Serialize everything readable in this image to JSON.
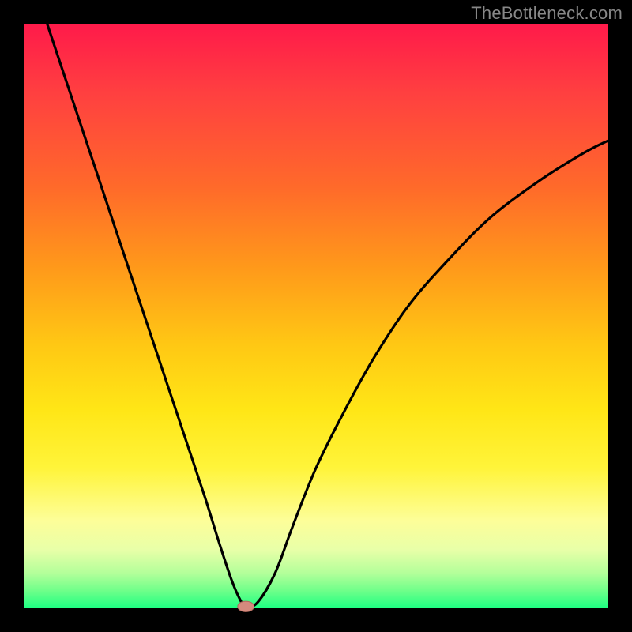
{
  "watermark": {
    "text": "TheBottleneck.com"
  },
  "colors": {
    "frame": "#000000",
    "curve": "#000000",
    "marker_fill": "#d58a7e",
    "marker_stroke": "#b06a5e"
  },
  "chart_data": {
    "type": "line",
    "title": "",
    "xlabel": "",
    "ylabel": "",
    "xlim": [
      0,
      100
    ],
    "ylim": [
      0,
      100
    ],
    "grid": false,
    "legend": false,
    "notes": "Axes and tick labels are not displayed; values are expressed as 0–100 percentages of the plot area. y=0 at bottom, y=100 at top.",
    "series": [
      {
        "name": "curve",
        "x": [
          4.0,
          7.0,
          10.0,
          13.0,
          16.0,
          19.0,
          22.0,
          25.0,
          28.0,
          31.0,
          33.5,
          35.5,
          37.0,
          38.0,
          40.0,
          43.0,
          46.0,
          50.0,
          55.0,
          60.0,
          66.0,
          73.0,
          80.0,
          88.0,
          96.0,
          100.0
        ],
        "y": [
          100.0,
          91.0,
          82.0,
          73.0,
          64.0,
          55.0,
          46.0,
          37.0,
          28.0,
          19.0,
          11.0,
          5.0,
          1.5,
          0.3,
          1.0,
          6.0,
          14.0,
          24.0,
          34.0,
          43.0,
          52.0,
          60.0,
          67.0,
          73.0,
          78.0,
          80.0
        ]
      }
    ],
    "marker": {
      "x": 38.0,
      "y": 0.3,
      "rx": 1.4,
      "ry": 0.9
    }
  }
}
